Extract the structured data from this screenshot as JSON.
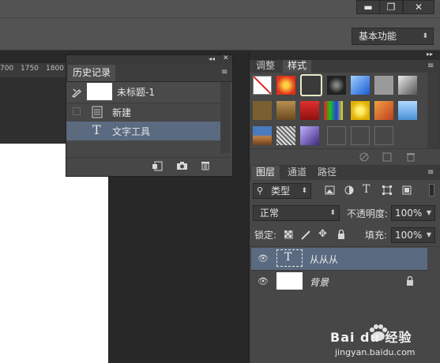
{
  "window": {
    "minimize_glyph": "▬",
    "restore_glyph": "❐",
    "close_glyph": "✕"
  },
  "options_bar": {
    "workspace_label": "基本功能",
    "workspace_arrow": "⬍"
  },
  "ruler": {
    "ticks": [
      "700",
      "1750",
      "1800"
    ]
  },
  "history_panel": {
    "collapse_glyph": "◂◂",
    "close_glyph": "✕",
    "tab_label": "历史记录",
    "menu_glyph": "≡",
    "snapshot_label": "未标题-1",
    "items": [
      {
        "label": "新建",
        "icon": "document-icon"
      },
      {
        "label": "文字工具",
        "icon": "type-tool-icon"
      }
    ],
    "footer_icons": [
      "new-document-from-state-icon",
      "camera-icon",
      "trash-icon"
    ]
  },
  "styles_panel": {
    "tabs": [
      "调整",
      "样式"
    ],
    "active_tab": "样式",
    "collapse_glyph": "▸▸",
    "menu_glyph": "≡",
    "footer_icons": [
      "clear-style-icon",
      "new-style-icon",
      "trash-icon"
    ]
  },
  "layers_panel": {
    "tabs": [
      "图层",
      "通道",
      "路径"
    ],
    "active_tab": "图层",
    "menu_glyph": "≡",
    "filter_label": "类型",
    "blend_mode": "正常",
    "opacity_label": "不透明度:",
    "opacity_value": "100%",
    "lock_label": "锁定:",
    "fill_label": "填充:",
    "fill_value": "100%",
    "layers": [
      {
        "name": "从从从",
        "type": "text",
        "selected": true
      },
      {
        "name": "背景",
        "type": "background",
        "locked": true
      }
    ]
  },
  "watermark": {
    "brand": "Bai du 经验",
    "url": "jingyan.baidu.com"
  },
  "colors": {
    "ui_bg": "#535353",
    "panel_bg": "#474747",
    "selection": "#5a6a80",
    "canvas": "#ffffff",
    "doc_bg": "#282828"
  }
}
